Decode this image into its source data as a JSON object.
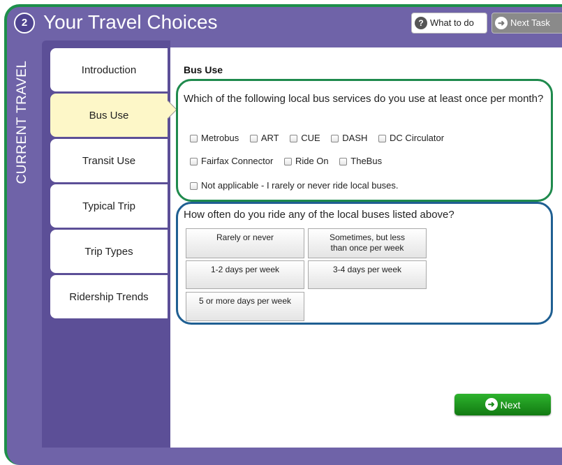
{
  "header": {
    "step_number": "2",
    "title": "Your Travel Choices",
    "what_to_do_label": "What to do",
    "next_task_label": "Next Task"
  },
  "side_label": "CURRENT TRAVEL",
  "nav": {
    "items": [
      {
        "label": "Introduction"
      },
      {
        "label": "Bus Use"
      },
      {
        "label": "Transit Use"
      },
      {
        "label": "Typical Trip"
      },
      {
        "label": "Trip Types"
      },
      {
        "label": "Ridership Trends"
      }
    ],
    "active_index": 1
  },
  "main": {
    "section_title": "Bus Use",
    "question1": "Which of the following local bus services do you use at least once per month?",
    "services_row1": [
      "Metrobus",
      "ART",
      "CUE",
      "DASH",
      "DC Circulator"
    ],
    "services_row2": [
      "Fairfax Connector",
      "Ride On",
      "TheBus"
    ],
    "not_applicable": "Not applicable - I rarely or never ride local buses.",
    "question2": "How often do you ride any of the local buses listed above?",
    "frequency_options": [
      "Rarely or never",
      "Sometimes, but less than once per week",
      "1-2 days per week",
      "3-4 days per week",
      "5 or more days per week"
    ],
    "next_label": "Next"
  },
  "colors": {
    "frame_purple": "#6f63a8",
    "nav_purple": "#5c4f97",
    "active_tab": "#fdf7c8",
    "green_highlight": "#1f8a4d",
    "blue_highlight": "#1f5f92",
    "next_green": "#1f9a1f"
  }
}
